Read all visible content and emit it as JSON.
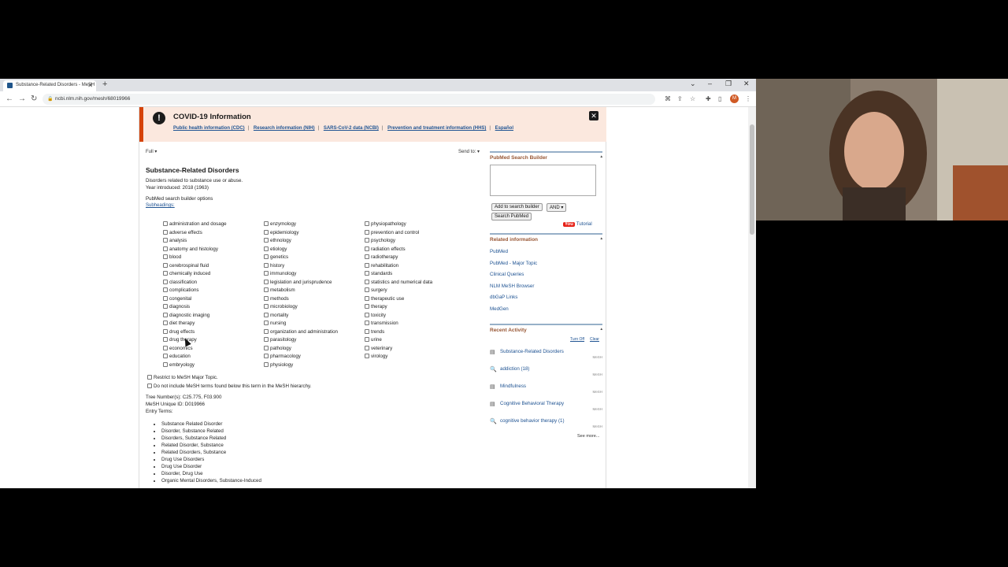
{
  "browser": {
    "tab_title": "Substance-Related Disorders - MeSH",
    "url": "ncbi.nlm.nih.gov/mesh/68019966",
    "avatar_letter": "M"
  },
  "covid": {
    "title": "COVID-19 Information",
    "links": [
      "Public health information (CDC)",
      "Research information (NIH)",
      "SARS-CoV-2 data (NCBI)",
      "Prevention and treatment information (HHS)",
      "Español"
    ]
  },
  "page": {
    "format": "Full",
    "send_to": "Send to:",
    "heading": "Substance-Related Disorders",
    "description": "Disorders related to substance use or abuse.",
    "year": "Year introduced: 2018 (1963)",
    "builder_options": "PubMed search builder options",
    "subheadings": "Subheadings:",
    "col1": [
      "administration and dosage",
      "adverse effects",
      "analysis",
      "anatomy and histology",
      "blood",
      "cerebrospinal fluid",
      "chemically induced",
      "classification",
      "complications",
      "congenital",
      "diagnosis",
      "diagnostic imaging",
      "diet therapy",
      "drug effects",
      "drug therapy",
      "economics",
      "education",
      "embryology"
    ],
    "col2": [
      "enzymology",
      "epidemiology",
      "ethnology",
      "etiology",
      "genetics",
      "history",
      "immunology",
      "legislation and jurisprudence",
      "metabolism",
      "methods",
      "microbiology",
      "mortality",
      "nursing",
      "organization and administration",
      "parasitology",
      "pathology",
      "pharmacology",
      "physiology"
    ],
    "col3": [
      "physiopathology",
      "prevention and control",
      "psychology",
      "radiation effects",
      "radiotherapy",
      "rehabilitation",
      "standards",
      "statistics and numerical data",
      "surgery",
      "therapeutic use",
      "therapy",
      "toxicity",
      "transmission",
      "trends",
      "urine",
      "veterinary",
      "virology"
    ],
    "restrict": "Restrict to MeSH Major Topic.",
    "no_include": "Do not include MeSH terms found below this term in the MeSH hierarchy.",
    "tree": "Tree Number(s): C25.775, F03.900",
    "unique_id": "MeSH Unique ID: D019966",
    "entry_terms_label": "Entry Terms:",
    "entry_terms": [
      "Substance Related Disorder",
      "Disorder, Substance Related",
      "Disorders, Substance Related",
      "Related Disorder, Substance",
      "Related Disorders, Substance",
      "Drug Use Disorders",
      "Drug Use Disorder",
      "Disorder, Drug Use",
      "Organic Mental Disorders, Substance-Induced"
    ]
  },
  "sidebar": {
    "builder_title": "PubMed Search Builder",
    "add_btn": "Add to search builder",
    "and_select": "AND",
    "search_btn": "Search PubMed",
    "youtube": "You",
    "tutorial": "Tutorial",
    "related_title": "Related information",
    "related": [
      "PubMed",
      "PubMed - Major Topic",
      "Clinical Queries",
      "NLM MeSH Browser",
      "dbGaP Links",
      "MedGen"
    ],
    "recent_title": "Recent Activity",
    "turn_off": "Turn Off",
    "clear": "Clear",
    "recent": [
      {
        "label": "Substance-Related Disorders",
        "tag": "MeSH",
        "icon": "document-icon"
      },
      {
        "label": "addiction (18)",
        "tag": "MeSH",
        "icon": "search-icon"
      },
      {
        "label": "Mindfulness",
        "tag": "MeSH",
        "icon": "document-icon"
      },
      {
        "label": "Cognitive Behavioral Therapy",
        "tag": "MeSH",
        "icon": "document-icon"
      },
      {
        "label": "cognitive behavior therapy (1)",
        "tag": "MeSH",
        "icon": "search-icon"
      }
    ],
    "see_more": "See more..."
  }
}
